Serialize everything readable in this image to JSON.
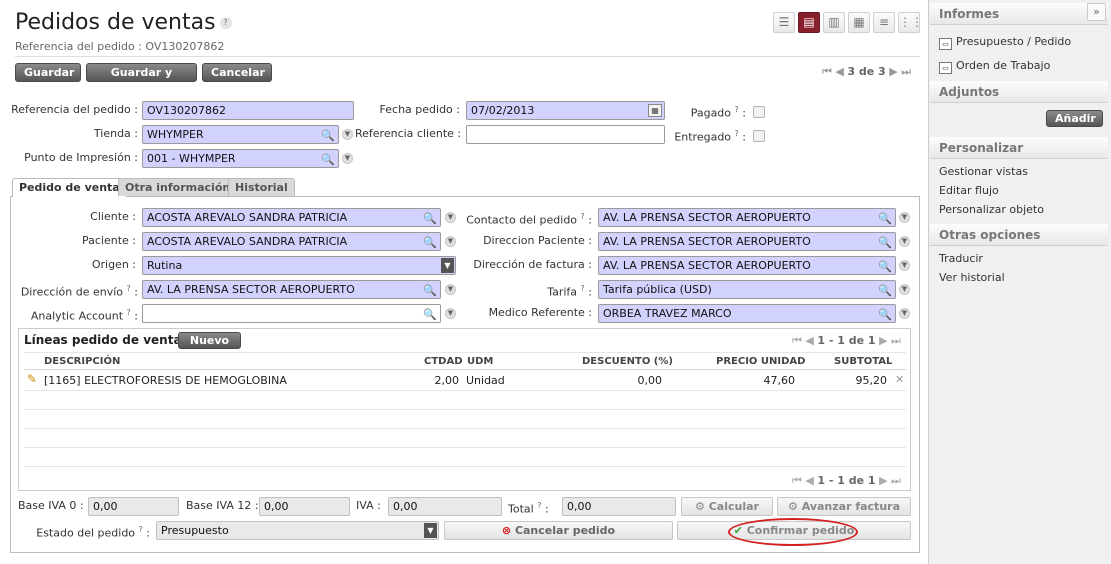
{
  "header": {
    "title": "Pedidos de ventas",
    "help": "?",
    "subtitle": "Referencia del pedido : OV130207862"
  },
  "view_switches": [
    "list-view-icon",
    "form-view-icon",
    "graph-view-icon",
    "calendar-view-icon",
    "gantt-view-icon",
    "kanban-view-icon"
  ],
  "toolbar": {
    "save": "Guardar",
    "save_edit": "Guardar y Editar",
    "cancel": "Cancelar"
  },
  "pager": {
    "text": "3 de 3"
  },
  "form": {
    "ref_label": "Referencia del pedido :",
    "ref_value": "OV130207862",
    "date_label": "Fecha pedido :",
    "date_value": "07/02/2013",
    "paid_label": "Pagado",
    "paid_q": "?",
    "paid_colon": ":",
    "shop_label": "Tienda :",
    "shop_value": "WHYMPER",
    "client_ref_label": "Referencia cliente :",
    "client_ref_value": "",
    "delivered_label": "Entregado",
    "delivered_q": "?",
    "delivered_colon": ":",
    "print_label": "Punto de Impresión :",
    "print_value": "001 - WHYMPER"
  },
  "tabs": [
    "Pedido de venta",
    "Otra información",
    "Historial"
  ],
  "sale": {
    "cliente_label": "Cliente :",
    "cliente_value": "ACOSTA AREVALO SANDRA PATRICIA",
    "contacto_label": "Contacto del pedido",
    "contacto_q": "?",
    "contacto_colon": ":",
    "contacto_value": "AV. LA PRENSA SECTOR AEROPUERTO",
    "paciente_label": "Paciente :",
    "paciente_value": "ACOSTA AREVALO SANDRA PATRICIA",
    "dir_paciente_label": "Direccion Paciente :",
    "dir_paciente_value": "AV. LA PRENSA SECTOR AEROPUERTO",
    "origen_label": "Origen :",
    "origen_value": "Rutina",
    "dir_factura_label": "Dirección de factura :",
    "dir_factura_value": "AV. LA PRENSA SECTOR AEROPUERTO",
    "dir_envio_label": "Dirección de envío",
    "dir_envio_q": "?",
    "dir_envio_colon": ":",
    "dir_envio_value": "AV. LA PRENSA SECTOR AEROPUERTO",
    "tarifa_label": "Tarifa",
    "tarifa_q": "?",
    "tarifa_colon": ":",
    "tarifa_value": "Tarifa pública (USD)",
    "analytic_label": "Analytic Account",
    "analytic_q": "?",
    "analytic_colon": ":",
    "analytic_value": "",
    "medico_label": "Medico Referente :",
    "medico_value": "ORBEA TRAVEZ MARCO"
  },
  "lines": {
    "title": "Líneas pedido de ventas",
    "new": "Nuevo",
    "pager": "1 - 1 de 1",
    "columns": [
      "DESCRIPCIÓN",
      "CTDAD",
      "UDM",
      "DESCUENTO (%)",
      "PRECIO UNIDAD",
      "SUBTOTAL"
    ],
    "rows": [
      {
        "desc": "[1165] ELECTROFORESIS DE HEMOGLOBINA",
        "qty": "2,00",
        "uom": "Unidad",
        "disc": "0,00",
        "price": "47,60",
        "subtotal": "95,20"
      }
    ]
  },
  "totals": {
    "base0_label": "Base IVA 0 :",
    "base0": "0,00",
    "base12_label": "Base IVA 12 :",
    "base12": "0,00",
    "iva_label": "IVA :",
    "iva": "0,00",
    "total_label": "Total",
    "total_q": "?",
    "total_colon": ":",
    "total": "0,00",
    "calc": "Calcular",
    "advance": "Avanzar factura"
  },
  "state": {
    "label": "Estado del pedido",
    "q": "?",
    "colon": ":",
    "value": "Presupuesto",
    "cancel": "Cancelar pedido",
    "confirm": "Confirmar pedido"
  },
  "sidebar": {
    "toggle": "»",
    "reports_title": "Informes",
    "reports": [
      "Presupuesto / Pedido",
      "Orden de Trabajo"
    ],
    "attach_title": "Adjuntos",
    "attach_add": "Añadir",
    "custom_title": "Personalizar",
    "custom": [
      "Gestionar vistas",
      "Editar flujo",
      "Personalizar objeto"
    ],
    "other_title": "Otras opciones",
    "other": [
      "Traducir",
      "Ver historial"
    ]
  }
}
